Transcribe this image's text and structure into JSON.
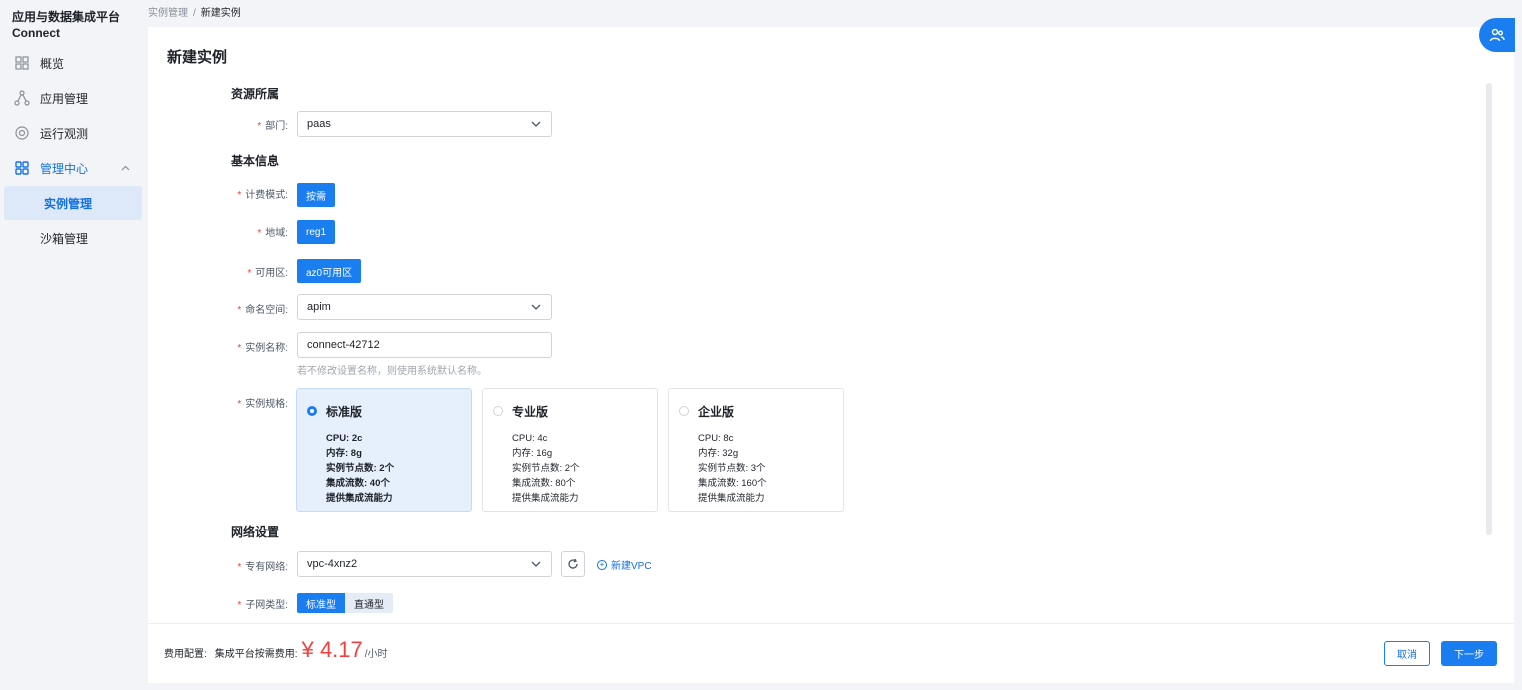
{
  "sidebar": {
    "brand_line1": "应用与数据集成平台",
    "brand_line2": "Connect",
    "items": [
      {
        "label": "概览",
        "icon": "grid-icon"
      },
      {
        "label": "应用管理",
        "icon": "nodes-icon"
      },
      {
        "label": "运行观测",
        "icon": "monitor-icon"
      },
      {
        "label": "管理中心",
        "icon": "apps-icon"
      }
    ],
    "sub_items": [
      {
        "label": "实例管理"
      },
      {
        "label": "沙箱管理"
      }
    ]
  },
  "breadcrumb": {
    "parent": "实例管理",
    "separator": "/",
    "current": "新建实例"
  },
  "page": {
    "title": "新建实例"
  },
  "form": {
    "section_resource": "资源所属",
    "section_basic": "基本信息",
    "section_network": "网络设置",
    "department": {
      "label": "部门:",
      "value": "paas"
    },
    "billing": {
      "label": "计费模式:",
      "value": "按需"
    },
    "region": {
      "label": "地域:",
      "value": "reg1"
    },
    "zone": {
      "label": "可用区:",
      "value": "az0可用区"
    },
    "namespace": {
      "label": "命名空间:",
      "value": "apim"
    },
    "instance_name": {
      "label": "实例名称:",
      "value": "connect-42712",
      "hint": "若不修改设置名称，则使用系统默认名称。"
    },
    "spec": {
      "label": "实例规格:",
      "options": [
        {
          "name": "标准版",
          "selected": true,
          "lines": [
            "CPU: 2c",
            "内存: 8g",
            "实例节点数: 2个",
            "集成流数: 40个",
            "提供集成流能力"
          ]
        },
        {
          "name": "专业版",
          "selected": false,
          "lines": [
            "CPU: 4c",
            "内存: 16g",
            "实例节点数: 2个",
            "集成流数: 80个",
            "提供集成流能力"
          ]
        },
        {
          "name": "企业版",
          "selected": false,
          "lines": [
            "CPU: 8c",
            "内存: 32g",
            "实例节点数: 3个",
            "集成流数: 160个",
            "提供集成流能力"
          ]
        }
      ]
    },
    "vpc": {
      "label": "专有网络:",
      "value": "vpc-4xnz2",
      "new_label": "新建VPC"
    },
    "subnet_type": {
      "label": "子网类型:",
      "options": [
        "标准型",
        "直通型"
      ]
    }
  },
  "footer": {
    "fee_label": "费用配置:",
    "fee_desc": "集成平台按需费用:",
    "currency": "¥",
    "price": "4.17",
    "unit": "/小时",
    "cancel_label": "取消",
    "next_label": "下一步"
  },
  "colors": {
    "primary": "#1a7df0",
    "required": "#f53f3f",
    "price": "#f53f3f"
  }
}
